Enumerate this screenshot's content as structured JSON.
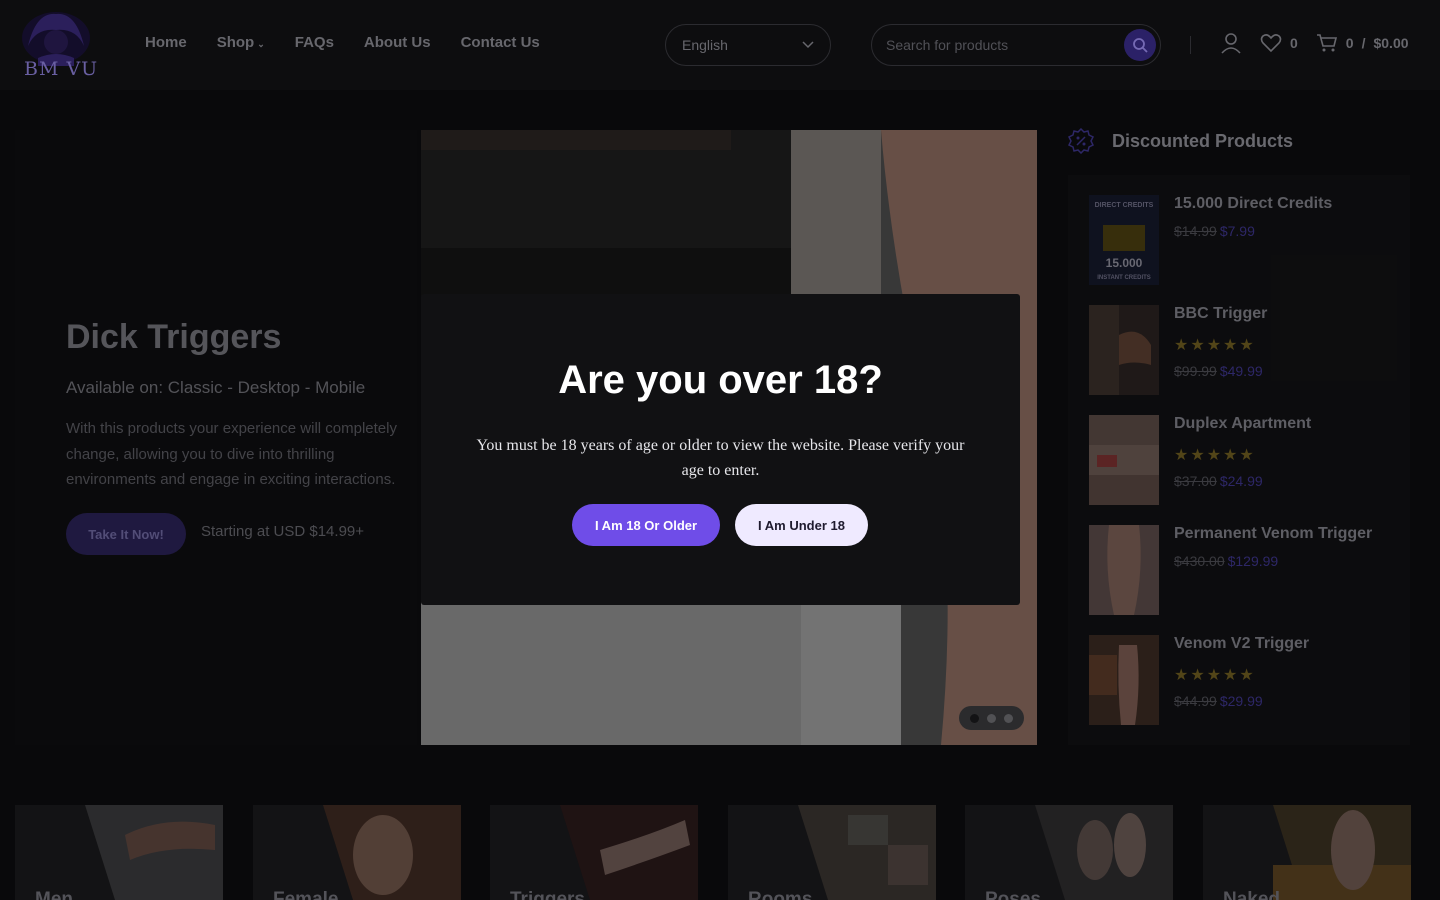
{
  "header": {
    "logo_text": "BM VU",
    "nav": [
      {
        "label": "Home"
      },
      {
        "label": "Shop"
      },
      {
        "label": "FAQs"
      },
      {
        "label": "About Us"
      },
      {
        "label": "Contact Us"
      }
    ],
    "language": "English",
    "search_placeholder": "Search for products",
    "wishlist_count": "0",
    "cart_count": "0",
    "cart_total": "$0.00",
    "cart_separator": "/"
  },
  "hero": {
    "title": "Dick Triggers",
    "subtitle": "Available on: Classic - Desktop - Mobile",
    "description": "With this products your experience will completely change, allowing you to dive into thrilling environments and engage in exciting interactions.",
    "button_label": "Take It Now!",
    "price_text": "Starting at USD $14.99+",
    "slides": 3,
    "active_slide": 1
  },
  "sidebar": {
    "title": "Discounted Products",
    "products": [
      {
        "name": "15.000 Direct Credits",
        "old_price": "$14.99",
        "new_price": "$7.99",
        "rating": null,
        "thumb_caption_top": "DIRECT CREDITS",
        "thumb_caption_mid": "15.000",
        "thumb_caption_bottom": "INSTANT CREDITS"
      },
      {
        "name": "BBC Trigger",
        "old_price": "$99.99",
        "new_price": "$49.99",
        "rating": 5
      },
      {
        "name": "Duplex Apartment",
        "old_price": "$37.00",
        "new_price": "$24.99",
        "rating": 5
      },
      {
        "name": "Permanent Venom Trigger",
        "old_price": "$430.00",
        "new_price": "$129.99",
        "rating": null
      },
      {
        "name": "Venom V2 Trigger",
        "old_price": "$44.99",
        "new_price": "$29.99",
        "rating": 5
      }
    ]
  },
  "categories": [
    {
      "label": "Men"
    },
    {
      "label": "Female"
    },
    {
      "label": "Triggers"
    },
    {
      "label": "Rooms"
    },
    {
      "label": "Poses"
    },
    {
      "label": "Naked"
    }
  ],
  "modal": {
    "title": "Are you over 18?",
    "text": "You must be 18 years of age or older to view the website. Please verify your age to enter.",
    "confirm_label": "I Am 18 Or Older",
    "deny_label": "I Am Under 18"
  },
  "colors": {
    "accent": "#6f4de8",
    "background": "#0d0d0f",
    "modal_bg": "#111113",
    "deny_button_bg": "#efeaff"
  }
}
